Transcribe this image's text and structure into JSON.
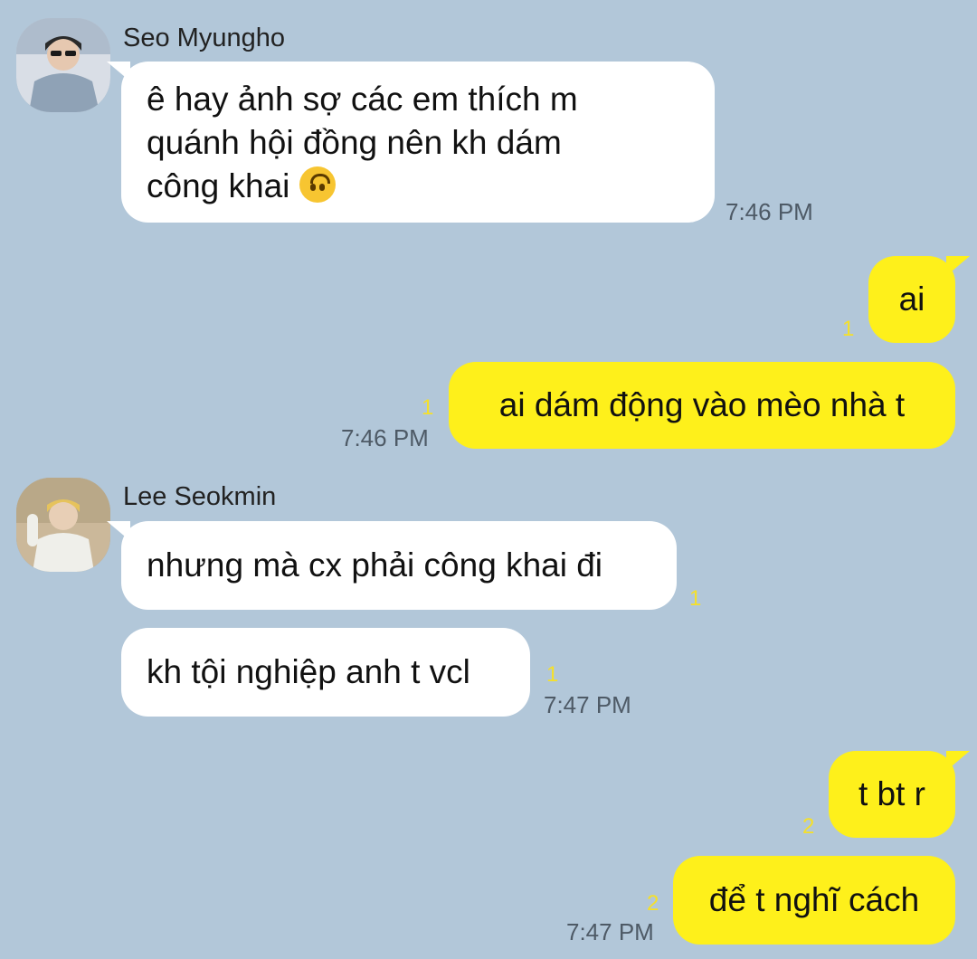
{
  "accent": {
    "incoming_bubble": "#ffffff",
    "outgoing_bubble": "#fef01b",
    "background": "#b2c7d9",
    "unread_count": "#f5e02a"
  },
  "messages": [
    {
      "id": "m1",
      "sender": "Seo Myungho",
      "text_lines": [
        "ê hay ảnh sợ các em thích m",
        "quánh hội đồng nên kh dám",
        "công khai"
      ],
      "emoji": "upside-down-face-icon",
      "time": "7:46 PM"
    },
    {
      "id": "m2",
      "text": "ai",
      "unread": "1"
    },
    {
      "id": "m3",
      "text": "ai dám động vào mèo nhà t",
      "unread": "1",
      "time": "7:46 PM"
    },
    {
      "id": "m4",
      "sender": "Lee Seokmin",
      "text": "nhưng mà cx phải công khai đi",
      "unread": "1"
    },
    {
      "id": "m5",
      "text": "kh tội nghiệp anh t vcl",
      "unread": "1",
      "time": "7:47 PM"
    },
    {
      "id": "m6",
      "text": "t bt r",
      "unread": "2"
    },
    {
      "id": "m7",
      "text": "để t nghĩ cách",
      "unread": "2",
      "time": "7:47 PM"
    }
  ]
}
